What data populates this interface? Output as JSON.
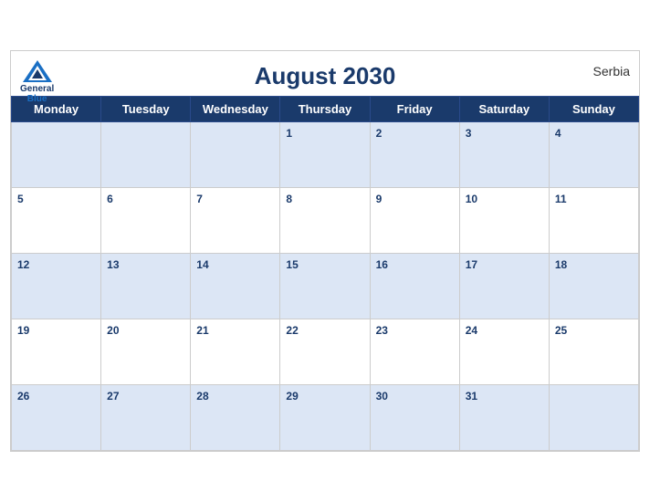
{
  "header": {
    "title": "August 2030",
    "country": "Serbia",
    "logo": {
      "general": "General",
      "blue": "Blue"
    }
  },
  "days_of_week": [
    "Monday",
    "Tuesday",
    "Wednesday",
    "Thursday",
    "Friday",
    "Saturday",
    "Sunday"
  ],
  "weeks": [
    [
      "",
      "",
      "",
      "1",
      "2",
      "3",
      "4"
    ],
    [
      "5",
      "6",
      "7",
      "8",
      "9",
      "10",
      "11"
    ],
    [
      "12",
      "13",
      "14",
      "15",
      "16",
      "17",
      "18"
    ],
    [
      "19",
      "20",
      "21",
      "22",
      "23",
      "24",
      "25"
    ],
    [
      "26",
      "27",
      "28",
      "29",
      "30",
      "31",
      ""
    ]
  ],
  "colors": {
    "header_bg": "#1a3a6b",
    "row_odd": "#dce6f5",
    "row_even": "#ffffff",
    "text": "#1a3a6b"
  }
}
